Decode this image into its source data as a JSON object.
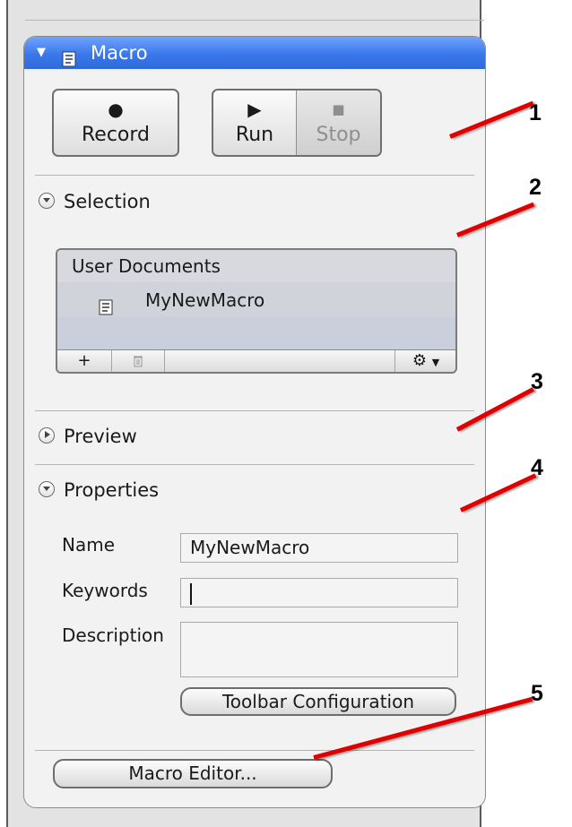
{
  "panel": {
    "title": "Macro",
    "header_color": "#3a78ea"
  },
  "controls": {
    "record_label": "Record",
    "run_label": "Run",
    "stop_label": "Stop",
    "stop_disabled": true
  },
  "selection": {
    "title": "Selection",
    "group_label": "User Documents",
    "items": [
      {
        "label": "MyNewMacro",
        "icon": "macro-document-icon",
        "selected": true
      }
    ],
    "toolbar": {
      "add": "+",
      "delete": "trash-icon",
      "actions": "gear-icon"
    }
  },
  "preview": {
    "title": "Preview",
    "expanded": false
  },
  "properties": {
    "title": "Properties",
    "name_label": "Name",
    "name_value": "MyNewMacro",
    "keywords_label": "Keywords",
    "keywords_value": "",
    "description_label": "Description",
    "description_value": "",
    "toolbar_config_label": "Toolbar Configuration"
  },
  "footer": {
    "macro_editor_label": "Macro Editor..."
  },
  "callouts": [
    "1",
    "2",
    "3",
    "4",
    "5"
  ],
  "accent_color": "#e00000"
}
